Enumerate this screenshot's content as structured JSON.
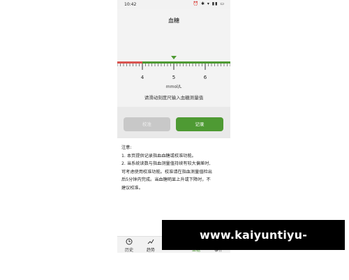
{
  "status_bar": {
    "time": "10:42",
    "icons": "⏰ ✱ ▾ ▮▮ ▭"
  },
  "header": {
    "title": "血糖"
  },
  "ruler": {
    "ticks": [
      "4",
      "5",
      "6"
    ],
    "selected_value": 5,
    "unit": "mmol/L",
    "accent_color": "#4e9a33",
    "low_color": "#d9534f"
  },
  "hint": "请滑动刻度尺输入血糖测量值",
  "buttons": {
    "calibrate": "校准",
    "record": "记录"
  },
  "notes": [
    "注意:",
    "1. 本页提供记录指血血糖或校准功能。",
    "2. 当系统读数与指血测量值持续有较大偏差时,",
    "可考虑使用校准功能。校准请在指血测量值检出",
    "后5分钟内完成。当血糖明显上升或下降时，不",
    "建议校准。"
  ],
  "bottom_nav": [
    {
      "label": "历史",
      "icon": "clock-icon"
    },
    {
      "label": "趋势",
      "icon": "chart-icon"
    },
    {
      "label": "",
      "icon": "add-icon"
    },
    {
      "label": "血糖",
      "icon": "drop-icon"
    },
    {
      "label": "事件",
      "icon": "event-icon"
    }
  ],
  "watermark": "www.kaiyuntiyu-betting.com"
}
